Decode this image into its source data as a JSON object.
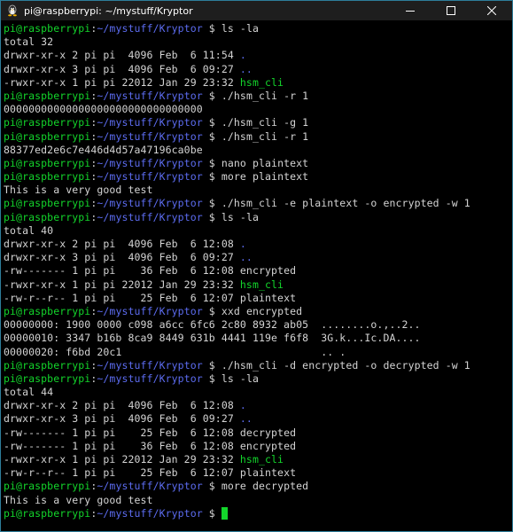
{
  "window": {
    "title": "pi@raspberrypi: ~/mystuff/Kryptor",
    "icons": {
      "app": "linux-terminal-icon",
      "minimize": "minimize-icon",
      "maximize": "maximize-icon",
      "close": "close-icon"
    }
  },
  "colors": {
    "prompt_user": "#13d62b",
    "prompt_path": "#5c6cf0",
    "exec_file": "#13d62b",
    "dir": "#5c6cf0",
    "text": "#d4d4d4"
  },
  "terminal": {
    "lines": [
      {
        "type": "prompt",
        "user": "pi@raspberrypi",
        "sep": ":",
        "path": "~/mystuff/Kryptor",
        "sym": " $ ",
        "cmd": "ls -la"
      },
      {
        "type": "out",
        "text": "total 32"
      },
      {
        "type": "ls",
        "pre": "drwxr-xr-x 2 pi pi  4096 Feb  6 11:54 ",
        "name": ".",
        "kind": "dir"
      },
      {
        "type": "ls",
        "pre": "drwxr-xr-x 3 pi pi  4096 Feb  6 09:27 ",
        "name": "..",
        "kind": "dir"
      },
      {
        "type": "ls",
        "pre": "-rwxr-xr-x 1 pi pi 22012 Jan 29 23:32 ",
        "name": "hsm_cli",
        "kind": "exec"
      },
      {
        "type": "prompt",
        "user": "pi@raspberrypi",
        "sep": ":",
        "path": "~/mystuff/Kryptor",
        "sym": " $ ",
        "cmd": "./hsm_cli -r 1"
      },
      {
        "type": "out",
        "text": "00000000000000000000000000000000"
      },
      {
        "type": "prompt",
        "user": "pi@raspberrypi",
        "sep": ":",
        "path": "~/mystuff/Kryptor",
        "sym": " $ ",
        "cmd": "./hsm_cli -g 1"
      },
      {
        "type": "prompt",
        "user": "pi@raspberrypi",
        "sep": ":",
        "path": "~/mystuff/Kryptor",
        "sym": " $ ",
        "cmd": "./hsm_cli -r 1"
      },
      {
        "type": "out",
        "text": "88377ed2e6c7e446d4d57a47196ca0be"
      },
      {
        "type": "prompt",
        "user": "pi@raspberrypi",
        "sep": ":",
        "path": "~/mystuff/Kryptor",
        "sym": " $ ",
        "cmd": "nano plaintext"
      },
      {
        "type": "prompt",
        "user": "pi@raspberrypi",
        "sep": ":",
        "path": "~/mystuff/Kryptor",
        "sym": " $ ",
        "cmd": "more plaintext"
      },
      {
        "type": "out",
        "text": "This is a very good test"
      },
      {
        "type": "prompt",
        "user": "pi@raspberrypi",
        "sep": ":",
        "path": "~/mystuff/Kryptor",
        "sym": " $ ",
        "cmd": "./hsm_cli -e plaintext -o encrypted -w 1"
      },
      {
        "type": "prompt",
        "user": "pi@raspberrypi",
        "sep": ":",
        "path": "~/mystuff/Kryptor",
        "sym": " $ ",
        "cmd": "ls -la"
      },
      {
        "type": "out",
        "text": "total 40"
      },
      {
        "type": "ls",
        "pre": "drwxr-xr-x 2 pi pi  4096 Feb  6 12:08 ",
        "name": ".",
        "kind": "dir"
      },
      {
        "type": "ls",
        "pre": "drwxr-xr-x 3 pi pi  4096 Feb  6 09:27 ",
        "name": "..",
        "kind": "dir"
      },
      {
        "type": "ls",
        "pre": "-rw------- 1 pi pi    36 Feb  6 12:08 ",
        "name": "encrypted",
        "kind": "file"
      },
      {
        "type": "ls",
        "pre": "-rwxr-xr-x 1 pi pi 22012 Jan 29 23:32 ",
        "name": "hsm_cli",
        "kind": "exec"
      },
      {
        "type": "ls",
        "pre": "-rw-r--r-- 1 pi pi    25 Feb  6 12:07 ",
        "name": "plaintext",
        "kind": "file"
      },
      {
        "type": "prompt",
        "user": "pi@raspberrypi",
        "sep": ":",
        "path": "~/mystuff/Kryptor",
        "sym": " $ ",
        "cmd": "xxd encrypted"
      },
      {
        "type": "out",
        "text": "00000000: 1900 0000 c098 a6cc 6fc6 2c80 8932 ab05  ........o.,..2.."
      },
      {
        "type": "out",
        "text": "00000010: 3347 b16b 8ca9 8449 631b 4441 119e f6f8  3G.k...Ic.DA...."
      },
      {
        "type": "out",
        "text": "00000020: f6bd 20c1                                .. ."
      },
      {
        "type": "prompt",
        "user": "pi@raspberrypi",
        "sep": ":",
        "path": "~/mystuff/Kryptor",
        "sym": " $ ",
        "cmd": "./hsm_cli -d encrypted -o decrypted -w 1"
      },
      {
        "type": "prompt",
        "user": "pi@raspberrypi",
        "sep": ":",
        "path": "~/mystuff/Kryptor",
        "sym": " $ ",
        "cmd": "ls -la"
      },
      {
        "type": "out",
        "text": "total 44"
      },
      {
        "type": "ls",
        "pre": "drwxr-xr-x 2 pi pi  4096 Feb  6 12:08 ",
        "name": ".",
        "kind": "dir"
      },
      {
        "type": "ls",
        "pre": "drwxr-xr-x 3 pi pi  4096 Feb  6 09:27 ",
        "name": "..",
        "kind": "dir"
      },
      {
        "type": "ls",
        "pre": "-rw------- 1 pi pi    25 Feb  6 12:08 ",
        "name": "decrypted",
        "kind": "file"
      },
      {
        "type": "ls",
        "pre": "-rw------- 1 pi pi    36 Feb  6 12:08 ",
        "name": "encrypted",
        "kind": "file"
      },
      {
        "type": "ls",
        "pre": "-rwxr-xr-x 1 pi pi 22012 Jan 29 23:32 ",
        "name": "hsm_cli",
        "kind": "exec"
      },
      {
        "type": "ls",
        "pre": "-rw-r--r-- 1 pi pi    25 Feb  6 12:07 ",
        "name": "plaintext",
        "kind": "file"
      },
      {
        "type": "prompt",
        "user": "pi@raspberrypi",
        "sep": ":",
        "path": "~/mystuff/Kryptor",
        "sym": " $ ",
        "cmd": "more decrypted"
      },
      {
        "type": "out",
        "text": "This is a very good test"
      },
      {
        "type": "prompt",
        "user": "pi@raspberrypi",
        "sep": ":",
        "path": "~/mystuff/Kryptor",
        "sym": " $ ",
        "cmd": "",
        "cursor": true
      }
    ]
  }
}
